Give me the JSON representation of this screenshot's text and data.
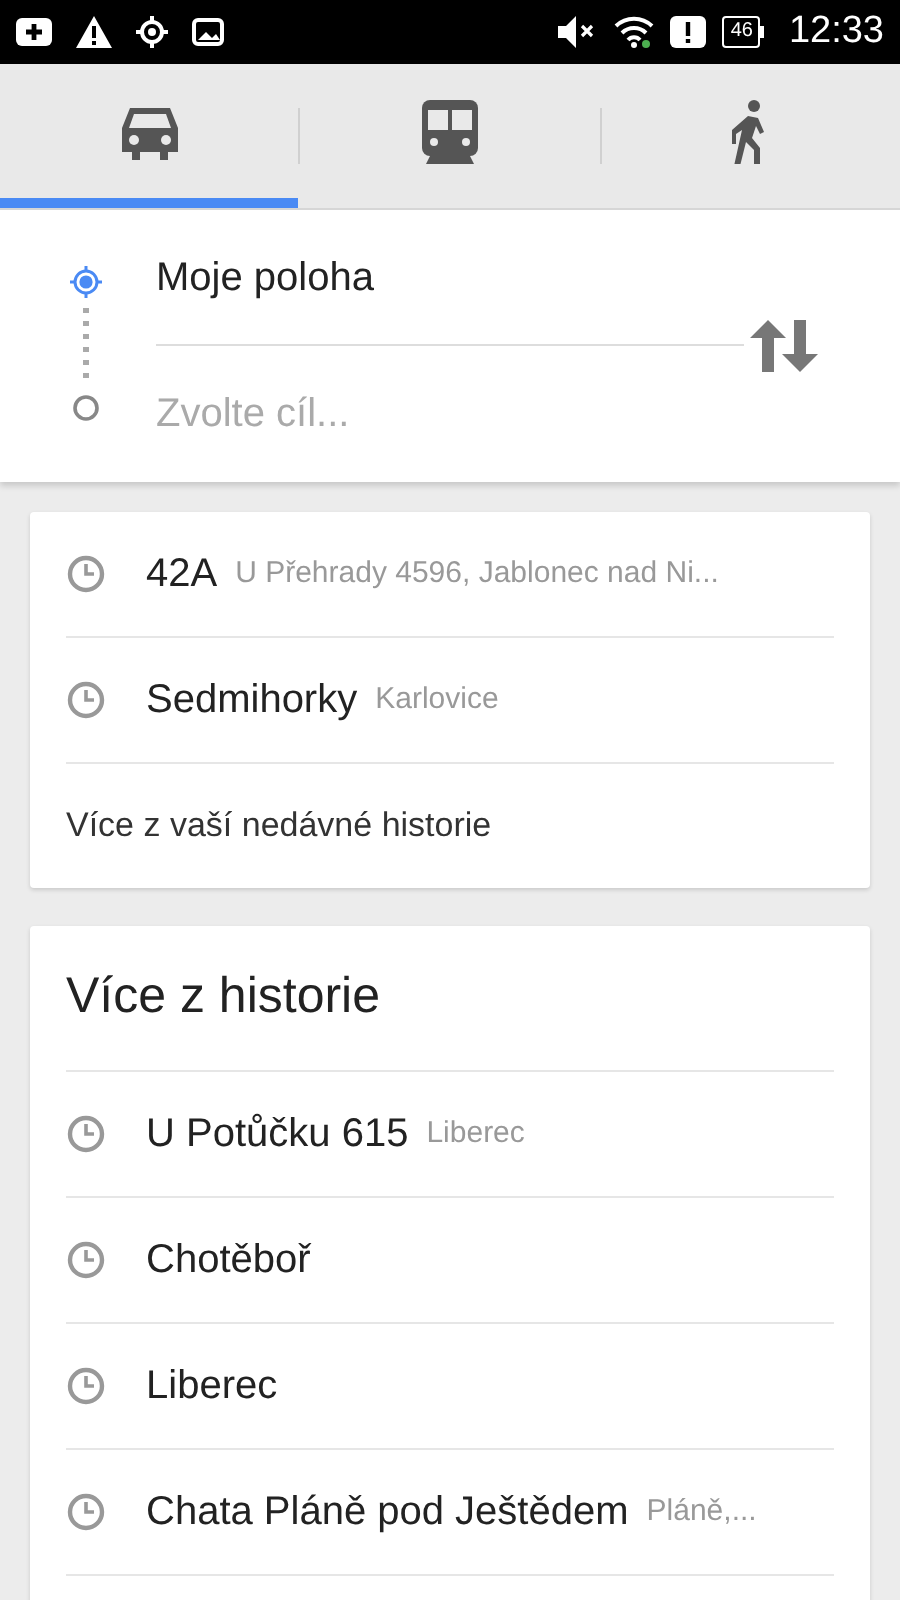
{
  "status_bar": {
    "battery": "46",
    "time": "12:33"
  },
  "tabs": [
    {
      "kind": "car",
      "selected": true
    },
    {
      "kind": "bus",
      "selected": false
    },
    {
      "kind": "walk",
      "selected": false
    }
  ],
  "route": {
    "origin": {
      "value": "Moje poloha"
    },
    "destination": {
      "placeholder": "Zvolte cíl..."
    }
  },
  "recent": {
    "items": [
      {
        "title": "42A",
        "subtitle": "U Přehrady 4596, Jablonec nad Ni..."
      },
      {
        "title": "Sedmihorky",
        "subtitle": "Karlovice"
      }
    ],
    "more_link": "Více z vaší nedávné historie"
  },
  "history": {
    "title": "Více z historie",
    "items": [
      {
        "title": "U Potůčku 615",
        "subtitle": "Liberec"
      },
      {
        "title": "Chotěboř"
      },
      {
        "title": "Liberec"
      },
      {
        "title": "Chata Pláně pod Ještědem",
        "subtitle": "Pláně,..."
      }
    ]
  }
}
